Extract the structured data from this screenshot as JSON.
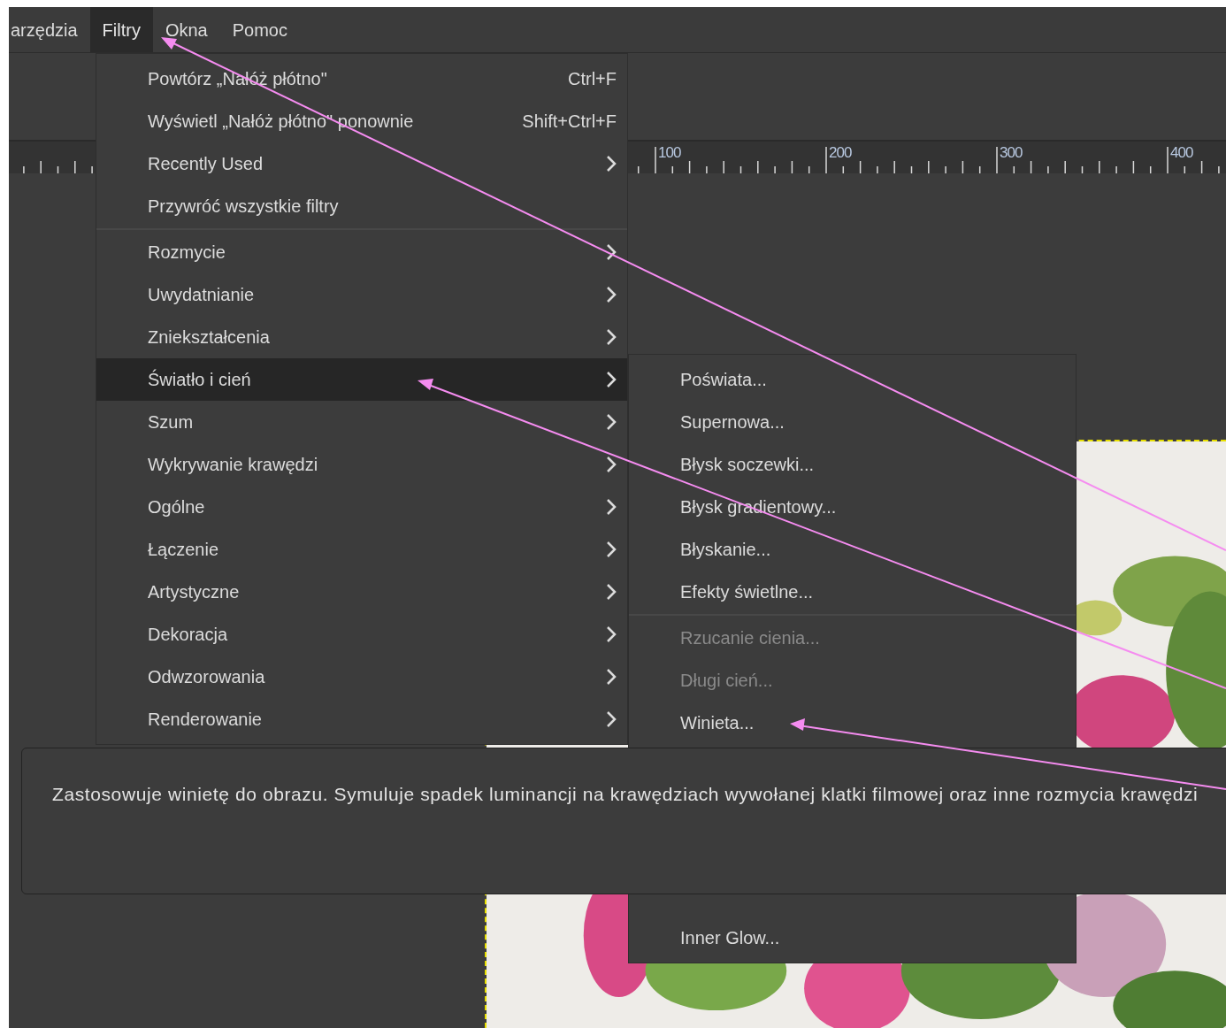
{
  "menubar": [
    {
      "label": "arzędzia",
      "selected": false
    },
    {
      "label": "Filtry",
      "selected": true
    },
    {
      "label": "Okna",
      "selected": false
    },
    {
      "label": "Pomoc",
      "selected": false
    }
  ],
  "ruler": {
    "labels": [
      "100",
      "200",
      "300",
      "400"
    ]
  },
  "filters_menu": {
    "items": [
      {
        "kind": "item",
        "label": "Powtórz „Nałóż płótno\"",
        "shortcut": "Ctrl+F",
        "has_submenu": false,
        "selected": false
      },
      {
        "kind": "item",
        "label": "Wyświetl „Nałóż płótno\" ponownie",
        "shortcut": "Shift+Ctrl+F",
        "has_submenu": false,
        "selected": false
      },
      {
        "kind": "item",
        "label": "Recently Used",
        "has_submenu": true,
        "selected": false
      },
      {
        "kind": "item",
        "label": "Przywróć wszystkie filtry",
        "has_submenu": false,
        "selected": false
      },
      {
        "kind": "separator"
      },
      {
        "kind": "item",
        "label": "Rozmycie",
        "has_submenu": true,
        "selected": false
      },
      {
        "kind": "item",
        "label": "Uwydatnianie",
        "has_submenu": true,
        "selected": false
      },
      {
        "kind": "item",
        "label": "Zniekształcenia",
        "has_submenu": true,
        "selected": false
      },
      {
        "kind": "item",
        "label": "Światło i cień",
        "has_submenu": true,
        "selected": true
      },
      {
        "kind": "item",
        "label": "Szum",
        "has_submenu": true,
        "selected": false
      },
      {
        "kind": "item",
        "label": "Wykrywanie krawędzi",
        "has_submenu": true,
        "selected": false
      },
      {
        "kind": "item",
        "label": "Ogólne",
        "has_submenu": true,
        "selected": false
      },
      {
        "kind": "item",
        "label": "Łączenie",
        "has_submenu": true,
        "selected": false
      },
      {
        "kind": "item",
        "label": "Artystyczne",
        "has_submenu": true,
        "selected": false
      },
      {
        "kind": "item",
        "label": "Dekoracja",
        "has_submenu": true,
        "selected": false
      },
      {
        "kind": "item",
        "label": "Odwzorowania",
        "has_submenu": true,
        "selected": false
      },
      {
        "kind": "item",
        "label": "Renderowanie",
        "has_submenu": true,
        "selected": false
      }
    ]
  },
  "light_shadow_submenu": {
    "items": [
      {
        "kind": "item",
        "label": "Poświata...",
        "disabled": false
      },
      {
        "kind": "item",
        "label": "Supernowa...",
        "disabled": false
      },
      {
        "kind": "item",
        "label": "Błysk soczewki...",
        "disabled": false
      },
      {
        "kind": "item",
        "label": "Błysk gradientowy...",
        "disabled": false
      },
      {
        "kind": "item",
        "label": "Błyskanie...",
        "disabled": false
      },
      {
        "kind": "item",
        "label": "Efekty świetlne...",
        "disabled": false
      },
      {
        "kind": "separator"
      },
      {
        "kind": "item",
        "label": "Rzucanie cienia...",
        "disabled": true
      },
      {
        "kind": "item",
        "label": "Długi cień...",
        "disabled": true
      },
      {
        "kind": "item",
        "label": "Winieta...",
        "disabled": false
      },
      {
        "kind": "hidden"
      },
      {
        "kind": "item",
        "label": "Inner Glow...",
        "disabled": false
      }
    ]
  },
  "tooltip": {
    "text": "Zastosowuje winietę do obrazu. Symuluje spadek luminancji na krawędziach wywołanej klatki filmowej oraz inne rozmycia krawędzi"
  }
}
